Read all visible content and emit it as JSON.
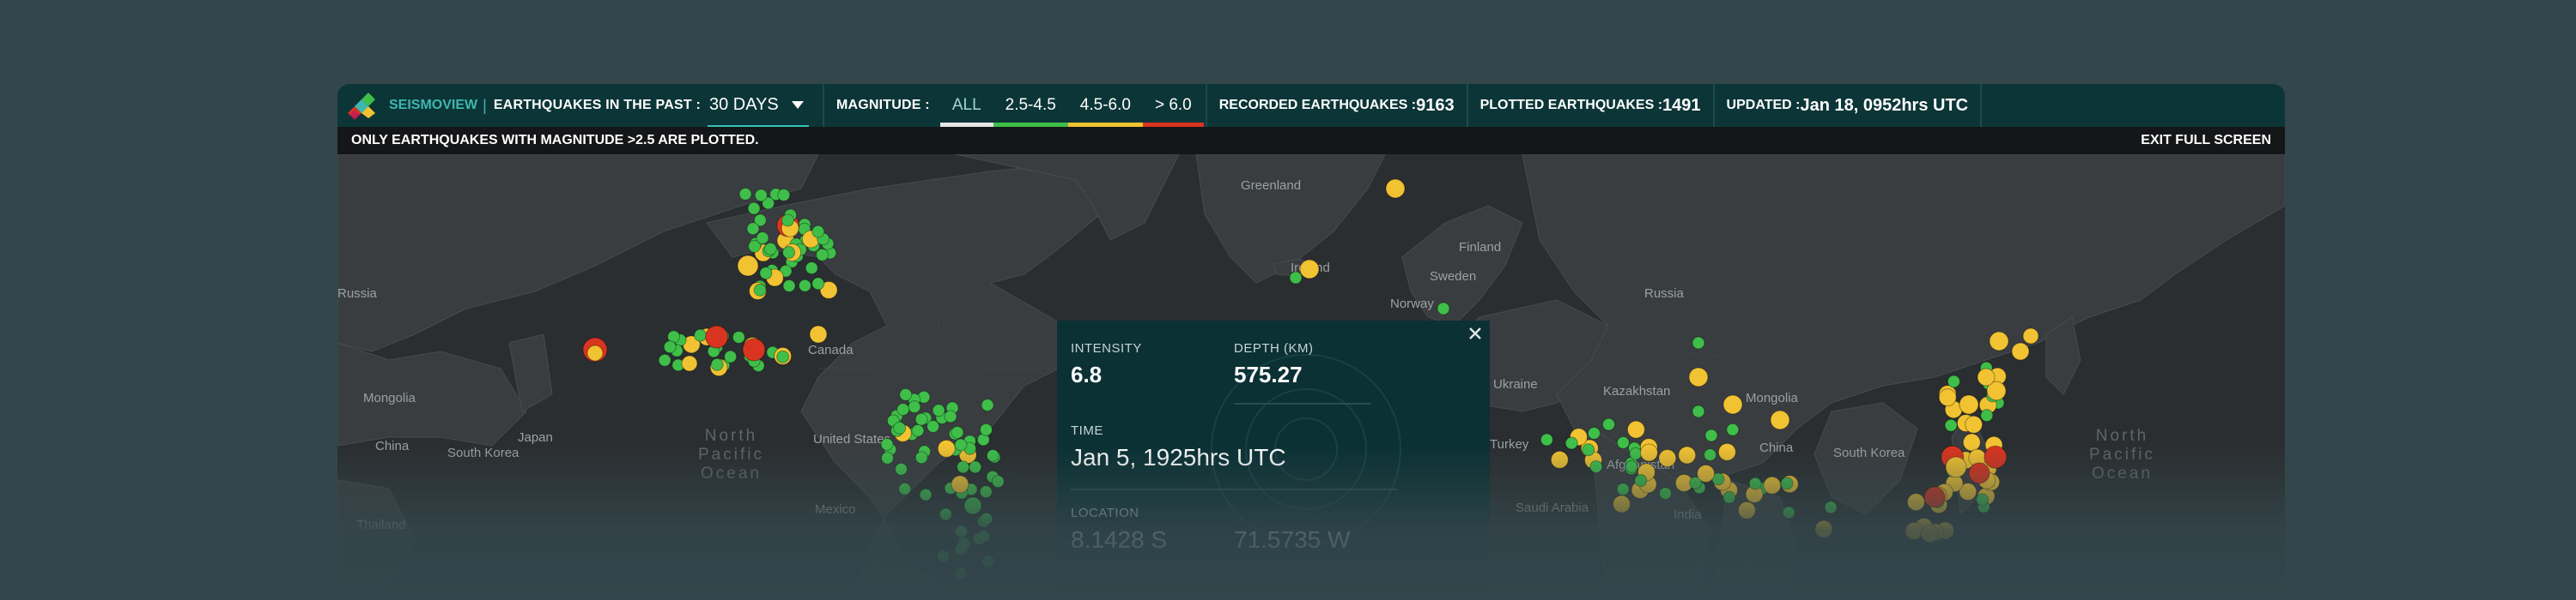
{
  "topbar": {
    "brand": "SEISMOVIEW",
    "separator": "|",
    "period_label": "EARTHQUAKES IN THE PAST :",
    "period_value": "30 DAYS",
    "magnitude_label": "MAGNITUDE :",
    "magnitude_filters": [
      {
        "label": "ALL",
        "color": "#e6e6e6"
      },
      {
        "label": "2.5-4.5",
        "color": "#3fbf4a"
      },
      {
        "label": "4.5-6.0",
        "color": "#f1c232"
      },
      {
        "label": "> 6.0",
        "color": "#d9341f"
      }
    ],
    "recorded_label": "RECORDED EARTHQUAKES :",
    "recorded_value": "9163",
    "plotted_label": "PLOTTED EARTHQUAKES :",
    "plotted_value": "1491",
    "updated_label": "UPDATED :",
    "updated_value": "Jan 18, 0952hrs UTC"
  },
  "subbar": {
    "notice": "ONLY EARTHQUAKES WITH MAGNITUDE >2.5 ARE PLOTTED.",
    "exit_label": "EXIT FULL SCREEN"
  },
  "map": {
    "places": [
      "Greenland",
      "Finland",
      "Sweden",
      "Norway",
      "Russia",
      "Russia",
      "Canada",
      "United States",
      "Mexico",
      "Mongolia",
      "China",
      "South Korea",
      "Japan",
      "Kazakhstan",
      "Mongolia",
      "China",
      "Afghanistan",
      "India",
      "South Korea",
      "Turkey",
      "Saudi Arabia",
      "Ukraine",
      "Ireland",
      "Thailand"
    ],
    "oceans": [
      {
        "lines": [
          "North",
          "Pacific",
          "Ocean"
        ]
      },
      {
        "lines": [
          "North",
          "Pacific",
          "Ocean"
        ]
      }
    ],
    "marker_colors": {
      "minor": "#3fbf4a",
      "moderate": "#f1c232",
      "strong": "#d9341f"
    }
  },
  "popup": {
    "intensity_label": "INTENSITY",
    "intensity_value": "6.8",
    "depth_label": "DEPTH (KM)",
    "depth_value": "575.27",
    "time_label": "TIME",
    "time_value": "Jan 5, 1925hrs UTC",
    "location_label": "LOCATION",
    "lat_value": "8.1428 S",
    "lon_value": "71.5735 W"
  }
}
